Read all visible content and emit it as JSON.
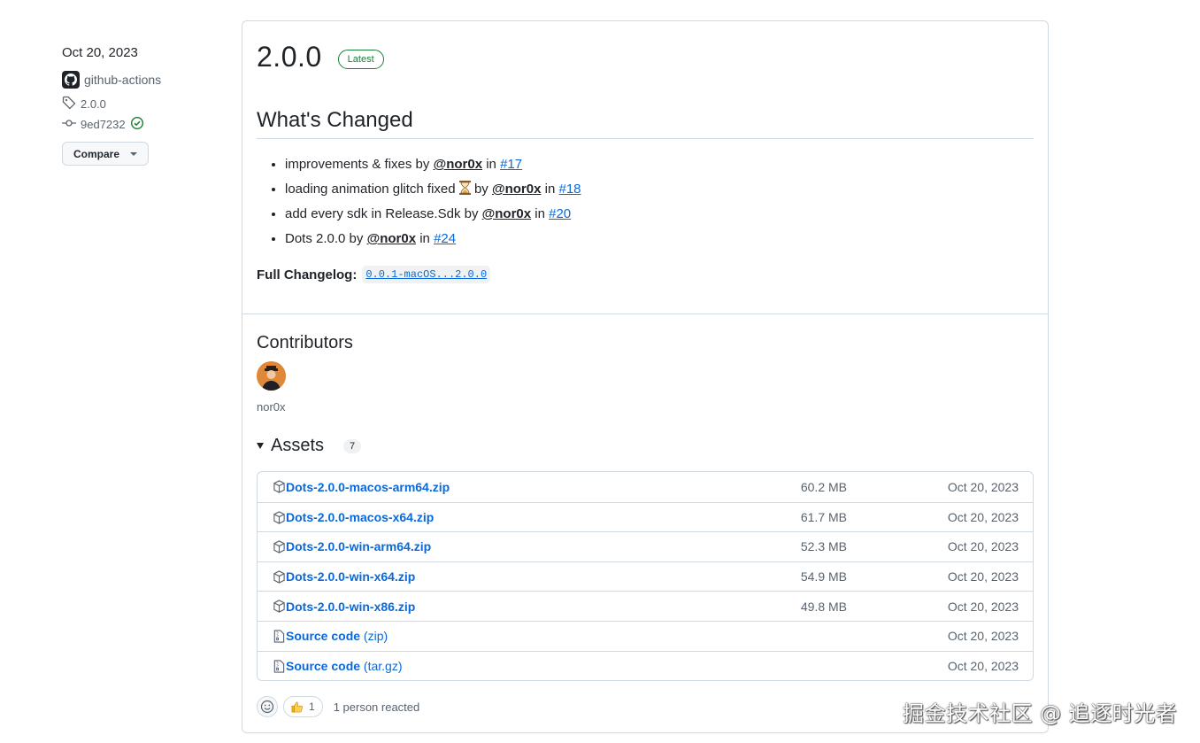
{
  "meta": {
    "date": "Oct 20, 2023",
    "author": "github-actions",
    "tag": "2.0.0",
    "commit": "9ed7232",
    "compare_label": "Compare"
  },
  "release": {
    "title": "2.0.0",
    "latest_badge": "Latest",
    "whats_changed_heading": "What's Changed",
    "changes": [
      {
        "text": "improvements & fixes by ",
        "mention": "@nor0x",
        "in": " in ",
        "issue": "#17"
      },
      {
        "text": "loading animation glitch fixed ",
        "emoji": "hourglass-icon",
        "by": " by ",
        "mention": "@nor0x",
        "in": " in ",
        "issue": "#18"
      },
      {
        "text": "add every sdk in Release.Sdk by ",
        "mention": "@nor0x",
        "in": " in ",
        "issue": "#20"
      },
      {
        "text": "Dots 2.0.0 by ",
        "mention": "@nor0x",
        "in": " in ",
        "issue": "#24"
      }
    ],
    "full_changelog_label": "Full Changelog",
    "full_changelog_colon": ":",
    "full_changelog_link": "0.0.1-macOS...2.0.0"
  },
  "contributors": {
    "heading": "Contributors",
    "names": [
      "nor0x"
    ]
  },
  "assets": {
    "heading": "Assets",
    "count": "7",
    "items": [
      {
        "name": "Dots-2.0.0-macos-arm64.zip",
        "suffix": "",
        "size": "60.2 MB",
        "date": "Oct 20, 2023",
        "icon": "package-icon"
      },
      {
        "name": "Dots-2.0.0-macos-x64.zip",
        "suffix": "",
        "size": "61.7 MB",
        "date": "Oct 20, 2023",
        "icon": "package-icon"
      },
      {
        "name": "Dots-2.0.0-win-arm64.zip",
        "suffix": "",
        "size": "52.3 MB",
        "date": "Oct 20, 2023",
        "icon": "package-icon"
      },
      {
        "name": "Dots-2.0.0-win-x64.zip",
        "suffix": "",
        "size": "54.9 MB",
        "date": "Oct 20, 2023",
        "icon": "package-icon"
      },
      {
        "name": "Dots-2.0.0-win-x86.zip",
        "suffix": "",
        "size": "49.8 MB",
        "date": "Oct 20, 2023",
        "icon": "package-icon"
      },
      {
        "name": "Source code",
        "suffix": " (zip)",
        "size": "",
        "date": "Oct 20, 2023",
        "icon": "file-zip-icon"
      },
      {
        "name": "Source code",
        "suffix": " (tar.gz)",
        "size": "",
        "date": "Oct 20, 2023",
        "icon": "file-zip-icon"
      }
    ]
  },
  "reactions": {
    "thumbs_count": "1",
    "summary": "1 person reacted"
  },
  "watermark": "掘金技术社区 @ 追逐时光者",
  "colors": {
    "link": "#0969da",
    "success": "#1a7f37",
    "border": "#d1d9e0",
    "text": "#1f2328",
    "muted": "#59636e"
  }
}
